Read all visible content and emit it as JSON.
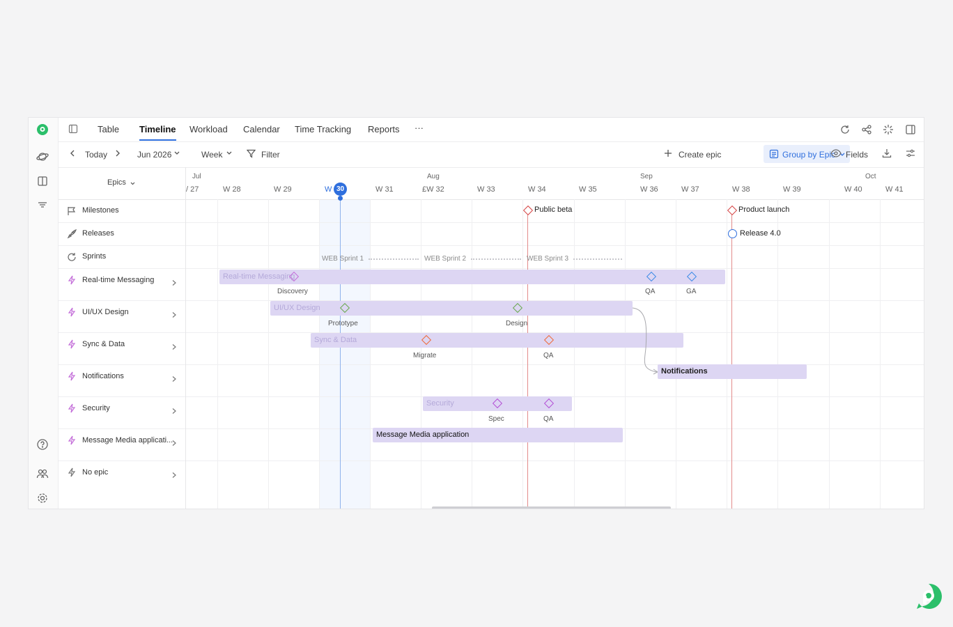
{
  "tabs": [
    "Table",
    "Timeline",
    "Workload",
    "Calendar",
    "Time Tracking",
    "Reports",
    "···"
  ],
  "active_tab": "Timeline",
  "toolbar": {
    "today": "Today",
    "month": "Jun 2026",
    "scale": "Week",
    "filter": "Filter",
    "create_epic": "Create epic",
    "group_by": "Group by Epic",
    "fields": "Fields"
  },
  "left": {
    "header": "Epics",
    "rows": [
      "Milestones",
      "Releases",
      "Sprints",
      "Real-time Messaging",
      "UI/UX Design",
      "Sync & Data",
      "Notifications",
      "Security",
      "Message Media applicati...",
      "No epic"
    ]
  },
  "months": [
    "Jul",
    "Aug",
    "Sep",
    "Oct"
  ],
  "weeks": [
    "/ 27",
    "W 28",
    "W 29",
    "W",
    "30",
    "W 31",
    "£W 32",
    "W 33",
    "W 34",
    "W 35",
    "W 36",
    "W 37",
    "W 38",
    "W 39",
    "W 40",
    "W 41"
  ],
  "milestones": [
    "Public beta",
    "Product launch"
  ],
  "releases": [
    "Release 4.0"
  ],
  "sprints": [
    "WEB Sprint 1",
    "WEB Sprint 2",
    "WEB Sprint 3"
  ],
  "epics": {
    "rtm": "Real-time Messaging",
    "ux": "UI/UX Design",
    "sync": "Sync & Data",
    "notif": "Notifications",
    "sec": "Security",
    "media": "Message Media application"
  },
  "markers": {
    "discovery": "Discovery",
    "qa": "QA",
    "ga": "GA",
    "prototype": "Prototype",
    "design": "Design",
    "migrate": "Migrate",
    "spec": "Spec"
  },
  "colors": {
    "accent": "#2f6fdd",
    "epic_bar": "#ddd6f3",
    "milestone": "#d64545",
    "brand": "#2bbf6a"
  }
}
